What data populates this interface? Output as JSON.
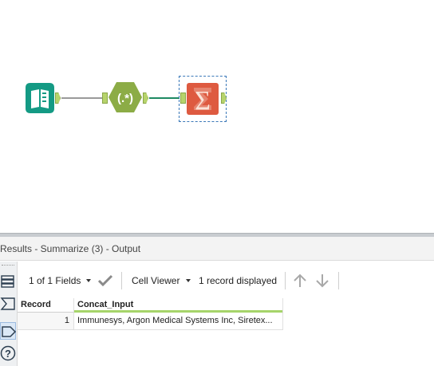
{
  "results": {
    "title": "Results - Summarize (3) - Output"
  },
  "toolbar": {
    "fields_label": "1 of 1 Fields",
    "view_label": "Cell Viewer",
    "status": "1 record displayed"
  },
  "grid": {
    "columns": [
      "Record",
      "Concat_Input"
    ],
    "rows": [
      {
        "record": "1",
        "concat_input": "Immunesys, Argon Medical Systems Inc,  Siretex..."
      }
    ]
  },
  "tools": {
    "input_icon": "book-icon",
    "regex_icon": "regex-hexagon-icon",
    "regex_glyph": "(.*)",
    "summarize_icon": "sigma-icon",
    "summarize_glyph": "Σ"
  },
  "colors": {
    "input_tool": "#149a84",
    "regex_tool": "#8cac46",
    "summarize_tool": "#de5a40",
    "anchor": "#b6d36b",
    "connection": "#1e8a62",
    "field_bar": "#a6d46a"
  }
}
